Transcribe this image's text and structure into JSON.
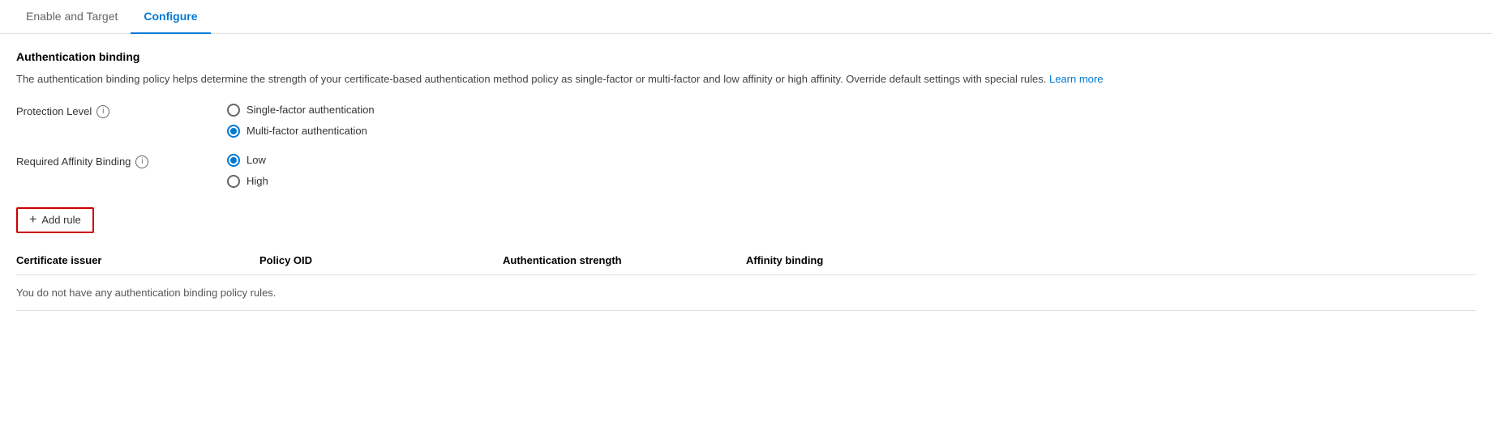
{
  "tabs": [
    {
      "id": "enable-target",
      "label": "Enable and Target",
      "active": false
    },
    {
      "id": "configure",
      "label": "Configure",
      "active": true
    }
  ],
  "section": {
    "title": "Authentication binding",
    "description": "The authentication binding policy helps determine the strength of your certificate-based authentication method policy as single-factor or multi-factor and low affinity or high affinity. Override default settings with special rules.",
    "learn_more_label": "Learn more"
  },
  "protection_level": {
    "label": "Protection Level",
    "options": [
      {
        "id": "single-factor",
        "label": "Single-factor authentication",
        "checked": false
      },
      {
        "id": "multi-factor",
        "label": "Multi-factor authentication",
        "checked": true
      }
    ]
  },
  "affinity_binding": {
    "label": "Required Affinity Binding",
    "options": [
      {
        "id": "low",
        "label": "Low",
        "checked": true
      },
      {
        "id": "high",
        "label": "High",
        "checked": false
      }
    ]
  },
  "add_rule_button": {
    "label": "Add rule",
    "plus": "+"
  },
  "table": {
    "columns": [
      {
        "id": "certificate-issuer",
        "label": "Certificate issuer"
      },
      {
        "id": "policy-oid",
        "label": "Policy OID"
      },
      {
        "id": "authentication-strength",
        "label": "Authentication strength"
      },
      {
        "id": "affinity-binding",
        "label": "Affinity binding"
      }
    ],
    "empty_message": "You do not have any authentication binding policy rules."
  }
}
